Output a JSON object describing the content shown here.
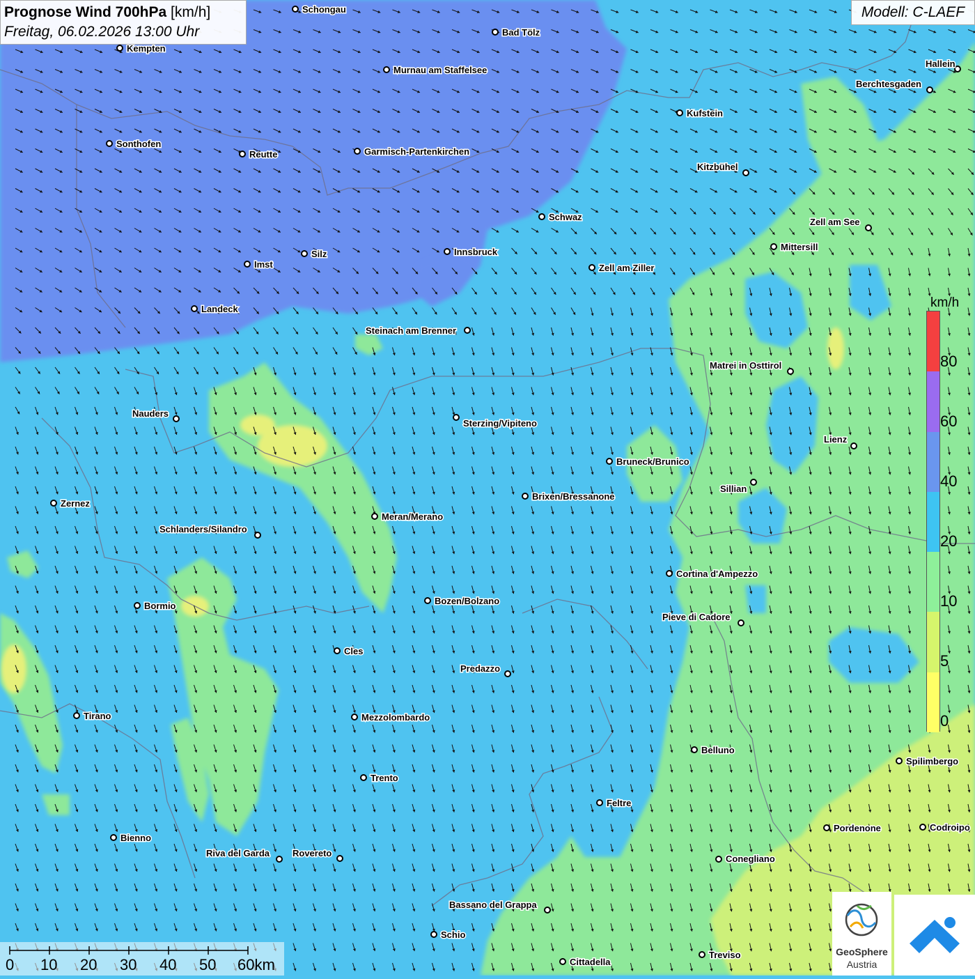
{
  "title": {
    "main_bold": "Prognose Wind 700hPa",
    "unit": "[km/h]",
    "date": "Freitag, 06.02.2026 13:00 Uhr"
  },
  "model": "Modell: C-LAEF",
  "legend": {
    "unit": "km/h",
    "labels": [
      "80",
      "60",
      "40",
      "20",
      "10",
      "5",
      "0"
    ],
    "colors": [
      "#f44040",
      "#9a6cf0",
      "#6a96ee",
      "#3ec4f2",
      "#8ef09a",
      "#d6f56c",
      "#ffff66"
    ]
  },
  "scale": {
    "labels": [
      "0",
      "10",
      "20",
      "30",
      "40",
      "50",
      "60km"
    ]
  },
  "logo": {
    "name_line1": "GeoSphere",
    "name_line2": "Austria"
  },
  "wind": {
    "north_zone_direction": "east-southeast",
    "south_zone_direction": "south-southeast"
  },
  "cities": [
    {
      "name": "Schongau"
    },
    {
      "name": "Bad Tölz"
    },
    {
      "name": "Kempten"
    },
    {
      "name": "Murnau am Staffelsee"
    },
    {
      "name": "Hallein"
    },
    {
      "name": "Berchtesgaden"
    },
    {
      "name": "Kufstein"
    },
    {
      "name": "Sonthofen"
    },
    {
      "name": "Reutte"
    },
    {
      "name": "Garmisch-Partenkirchen"
    },
    {
      "name": "Kitzbühel"
    },
    {
      "name": "Schwaz"
    },
    {
      "name": "Zell am See"
    },
    {
      "name": "Mittersill"
    },
    {
      "name": "Silz"
    },
    {
      "name": "Innsbruck"
    },
    {
      "name": "Imst"
    },
    {
      "name": "Zell am Ziller"
    },
    {
      "name": "Landeck"
    },
    {
      "name": "Steinach am Brenner"
    },
    {
      "name": "Matrei in Osttirol"
    },
    {
      "name": "Nauders"
    },
    {
      "name": "Sterzing/Vipiteno"
    },
    {
      "name": "Lienz"
    },
    {
      "name": "Bruneck/Brunico"
    },
    {
      "name": "Sillian"
    },
    {
      "name": "Brixen/Bressanone"
    },
    {
      "name": "Zernez"
    },
    {
      "name": "Meran/Merano"
    },
    {
      "name": "Schlanders/Silandro"
    },
    {
      "name": "Cortina d'Ampezzo"
    },
    {
      "name": "Bozen/Bolzano"
    },
    {
      "name": "Bormio"
    },
    {
      "name": "Pieve di Cadore"
    },
    {
      "name": "Cles"
    },
    {
      "name": "Predazzo"
    },
    {
      "name": "Tirano"
    },
    {
      "name": "Mezzolombardo"
    },
    {
      "name": "Belluno"
    },
    {
      "name": "Spilimbergo"
    },
    {
      "name": "Trento"
    },
    {
      "name": "Feltre"
    },
    {
      "name": "Bienno"
    },
    {
      "name": "Pordenone"
    },
    {
      "name": "Codroipo"
    },
    {
      "name": "Riva del Garda"
    },
    {
      "name": "Rovereto"
    },
    {
      "name": "Conegliano"
    },
    {
      "name": "Bassano del Grappa"
    },
    {
      "name": "Schio"
    },
    {
      "name": "Treviso"
    },
    {
      "name": "Cittadella"
    }
  ]
}
